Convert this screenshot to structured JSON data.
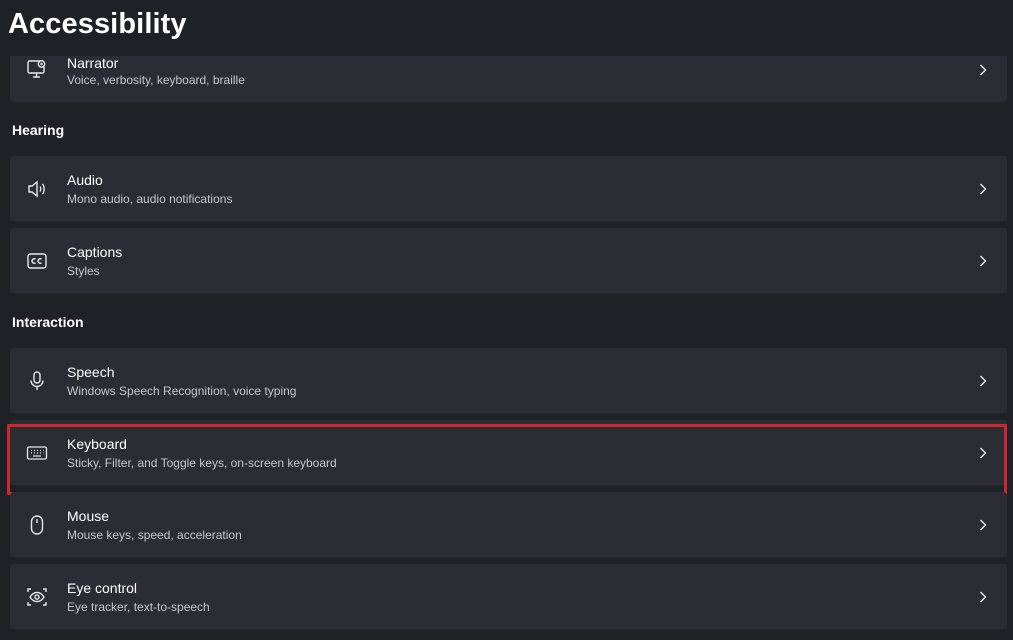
{
  "page": {
    "title": "Accessibility"
  },
  "sections": {
    "hearing": "Hearing",
    "interaction": "Interaction"
  },
  "items": {
    "narrator": {
      "title": "Narrator",
      "subtitle": "Voice, verbosity, keyboard, braille",
      "icon": "narrator-icon"
    },
    "audio": {
      "title": "Audio",
      "subtitle": "Mono audio, audio notifications",
      "icon": "speaker-icon"
    },
    "captions": {
      "title": "Captions",
      "subtitle": "Styles",
      "icon": "captions-icon"
    },
    "speech": {
      "title": "Speech",
      "subtitle": "Windows Speech Recognition, voice typing",
      "icon": "microphone-icon"
    },
    "keyboard": {
      "title": "Keyboard",
      "subtitle": "Sticky, Filter, and Toggle keys, on-screen keyboard",
      "icon": "keyboard-icon",
      "highlighted": true
    },
    "mouse": {
      "title": "Mouse",
      "subtitle": "Mouse keys, speed, acceleration",
      "icon": "mouse-icon"
    },
    "eye_control": {
      "title": "Eye control",
      "subtitle": "Eye tracker, text-to-speech",
      "icon": "eye-control-icon"
    }
  },
  "colors": {
    "background": "#1e2227",
    "card": "#2a2e34",
    "highlight": "#d0262e"
  }
}
